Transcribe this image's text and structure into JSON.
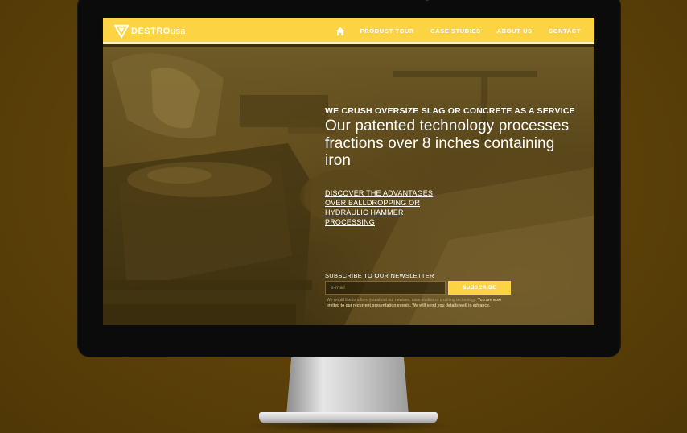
{
  "brand": {
    "logo_main": "DESTRO",
    "logo_accent": "USA"
  },
  "nav": {
    "home_icon": "home-icon",
    "items": [
      {
        "label": "PRODUCT TOUR"
      },
      {
        "label": "CASE STUDIES"
      },
      {
        "label": "ABOUT US"
      },
      {
        "label": "CONTACT"
      }
    ]
  },
  "hero": {
    "eyebrow": "WE CRUSH OVERSIZE SLAG OR CONCRETE AS A SERVICE",
    "headline": "Our patented technology processes fractions over 8 inches containing iron",
    "discover_link": "DISCOVER THE ADVANTAGES OVER BALLDROPPING OR HYDRAULIC HAMMER PROCESSING"
  },
  "newsletter": {
    "label": "SUBSCRIBE TO OUR NEWSLETTER",
    "input_placeholder": "e-mail",
    "button_label": "SUBSCRIBE",
    "note_regular": "We would like to inform you about our newsles, case studies or crushing technology.",
    "note_strong": "You are also invited to our recurrent presentation events. We will send you details well in advance."
  },
  "colors": {
    "accent": "#fcd342",
    "background": "#5a3f08",
    "bezel": "#0b0b0c"
  }
}
